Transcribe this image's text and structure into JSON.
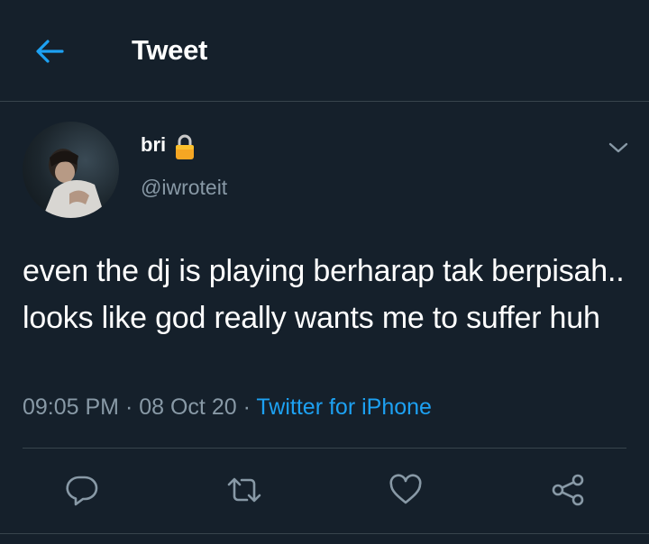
{
  "header": {
    "title": "Tweet",
    "back_icon": "back-arrow-icon"
  },
  "author": {
    "display_name": "bri",
    "handle": "@iwroteit",
    "protected_icon": "lock-icon"
  },
  "tweet": {
    "text": "even the dj is playing berharap tak berpisah.. looks like god really wants me to suffer huh",
    "time": "09:05 PM",
    "separator": " · ",
    "date": "08 Oct 20",
    "source": "Twitter for iPhone"
  },
  "actions": {
    "reply_icon": "reply-icon",
    "retweet_icon": "retweet-icon",
    "like_icon": "like-heart-icon",
    "share_icon": "share-icon"
  },
  "colors": {
    "background": "#15202b",
    "accent": "#1da1f2",
    "muted_text": "#8899a6",
    "divider": "#38444d"
  }
}
